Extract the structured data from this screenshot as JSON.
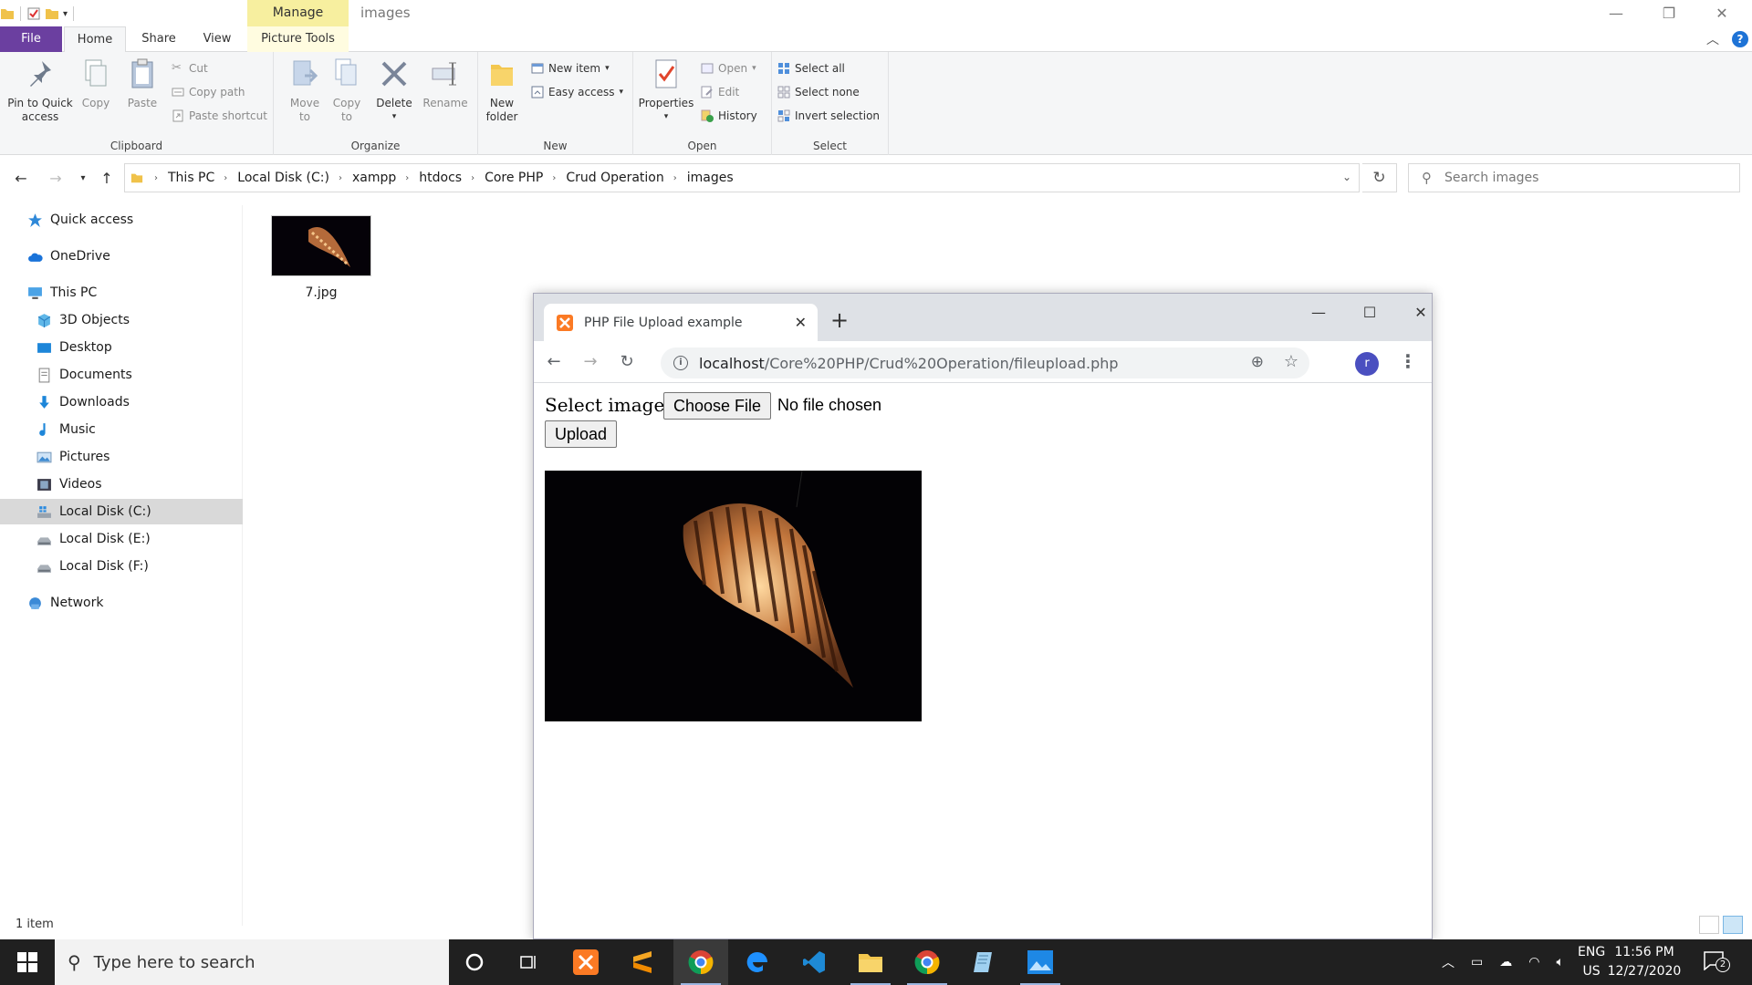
{
  "explorer": {
    "window_title": "images",
    "context_tab": "Manage",
    "tabs": [
      "File",
      "Home",
      "Share",
      "View",
      "Picture Tools"
    ],
    "ribbon": {
      "clipboard": {
        "label": "Clipboard",
        "pin": [
          "Pin to Quick",
          "access"
        ],
        "copy": "Copy",
        "paste": "Paste",
        "cut": "Cut",
        "copy_path": "Copy path",
        "paste_shortcut": "Paste shortcut"
      },
      "organize": {
        "label": "Organize",
        "move_to": [
          "Move",
          "to"
        ],
        "copy_to": [
          "Copy",
          "to"
        ],
        "delete": "Delete",
        "rename": "Rename"
      },
      "new": {
        "label": "New",
        "new_folder": [
          "New",
          "folder"
        ],
        "new_item": "New item",
        "easy_access": "Easy access"
      },
      "open": {
        "label": "Open",
        "properties": "Properties",
        "open": "Open",
        "edit": "Edit",
        "history": "History"
      },
      "select": {
        "label": "Select",
        "select_all": "Select all",
        "select_none": "Select none",
        "invert": "Invert selection"
      }
    },
    "breadcrumb": [
      "This PC",
      "Local Disk (C:)",
      "xampp",
      "htdocs",
      "Core PHP",
      "Crud Operation",
      "images"
    ],
    "search_placeholder": "Search images",
    "nav": {
      "quick_access": "Quick access",
      "onedrive": "OneDrive",
      "this_pc": "This PC",
      "objects3d": "3D Objects",
      "desktop": "Desktop",
      "documents": "Documents",
      "downloads": "Downloads",
      "music": "Music",
      "pictures": "Pictures",
      "videos": "Videos",
      "disk_c": "Local Disk (C:)",
      "disk_e": "Local Disk (E:)",
      "disk_f": "Local Disk (F:)",
      "network": "Network"
    },
    "file": {
      "name": "7.jpg"
    },
    "status": "1 item"
  },
  "browser": {
    "tab_title": "PHP File Upload example",
    "url_host": "localhost",
    "url_path": "/Core%20PHP/Crud%20Operation/fileupload.php",
    "avatar_letter": "r",
    "page": {
      "label": "Select image :",
      "choose_file": "Choose File",
      "no_file": "No file chosen",
      "upload": "Upload"
    }
  },
  "taskbar": {
    "search_placeholder": "Type here to search",
    "lang_top": "ENG",
    "lang_bottom": "US",
    "time": "11:56 PM",
    "date": "12/27/2020",
    "notifications": "2"
  },
  "colors": {
    "file_tab": "#6b3fa0",
    "manage_tab": "#f7ef9f",
    "taskbar": "#202020",
    "avatar": "#4a4fc0",
    "xampp": "#fb7a24"
  }
}
